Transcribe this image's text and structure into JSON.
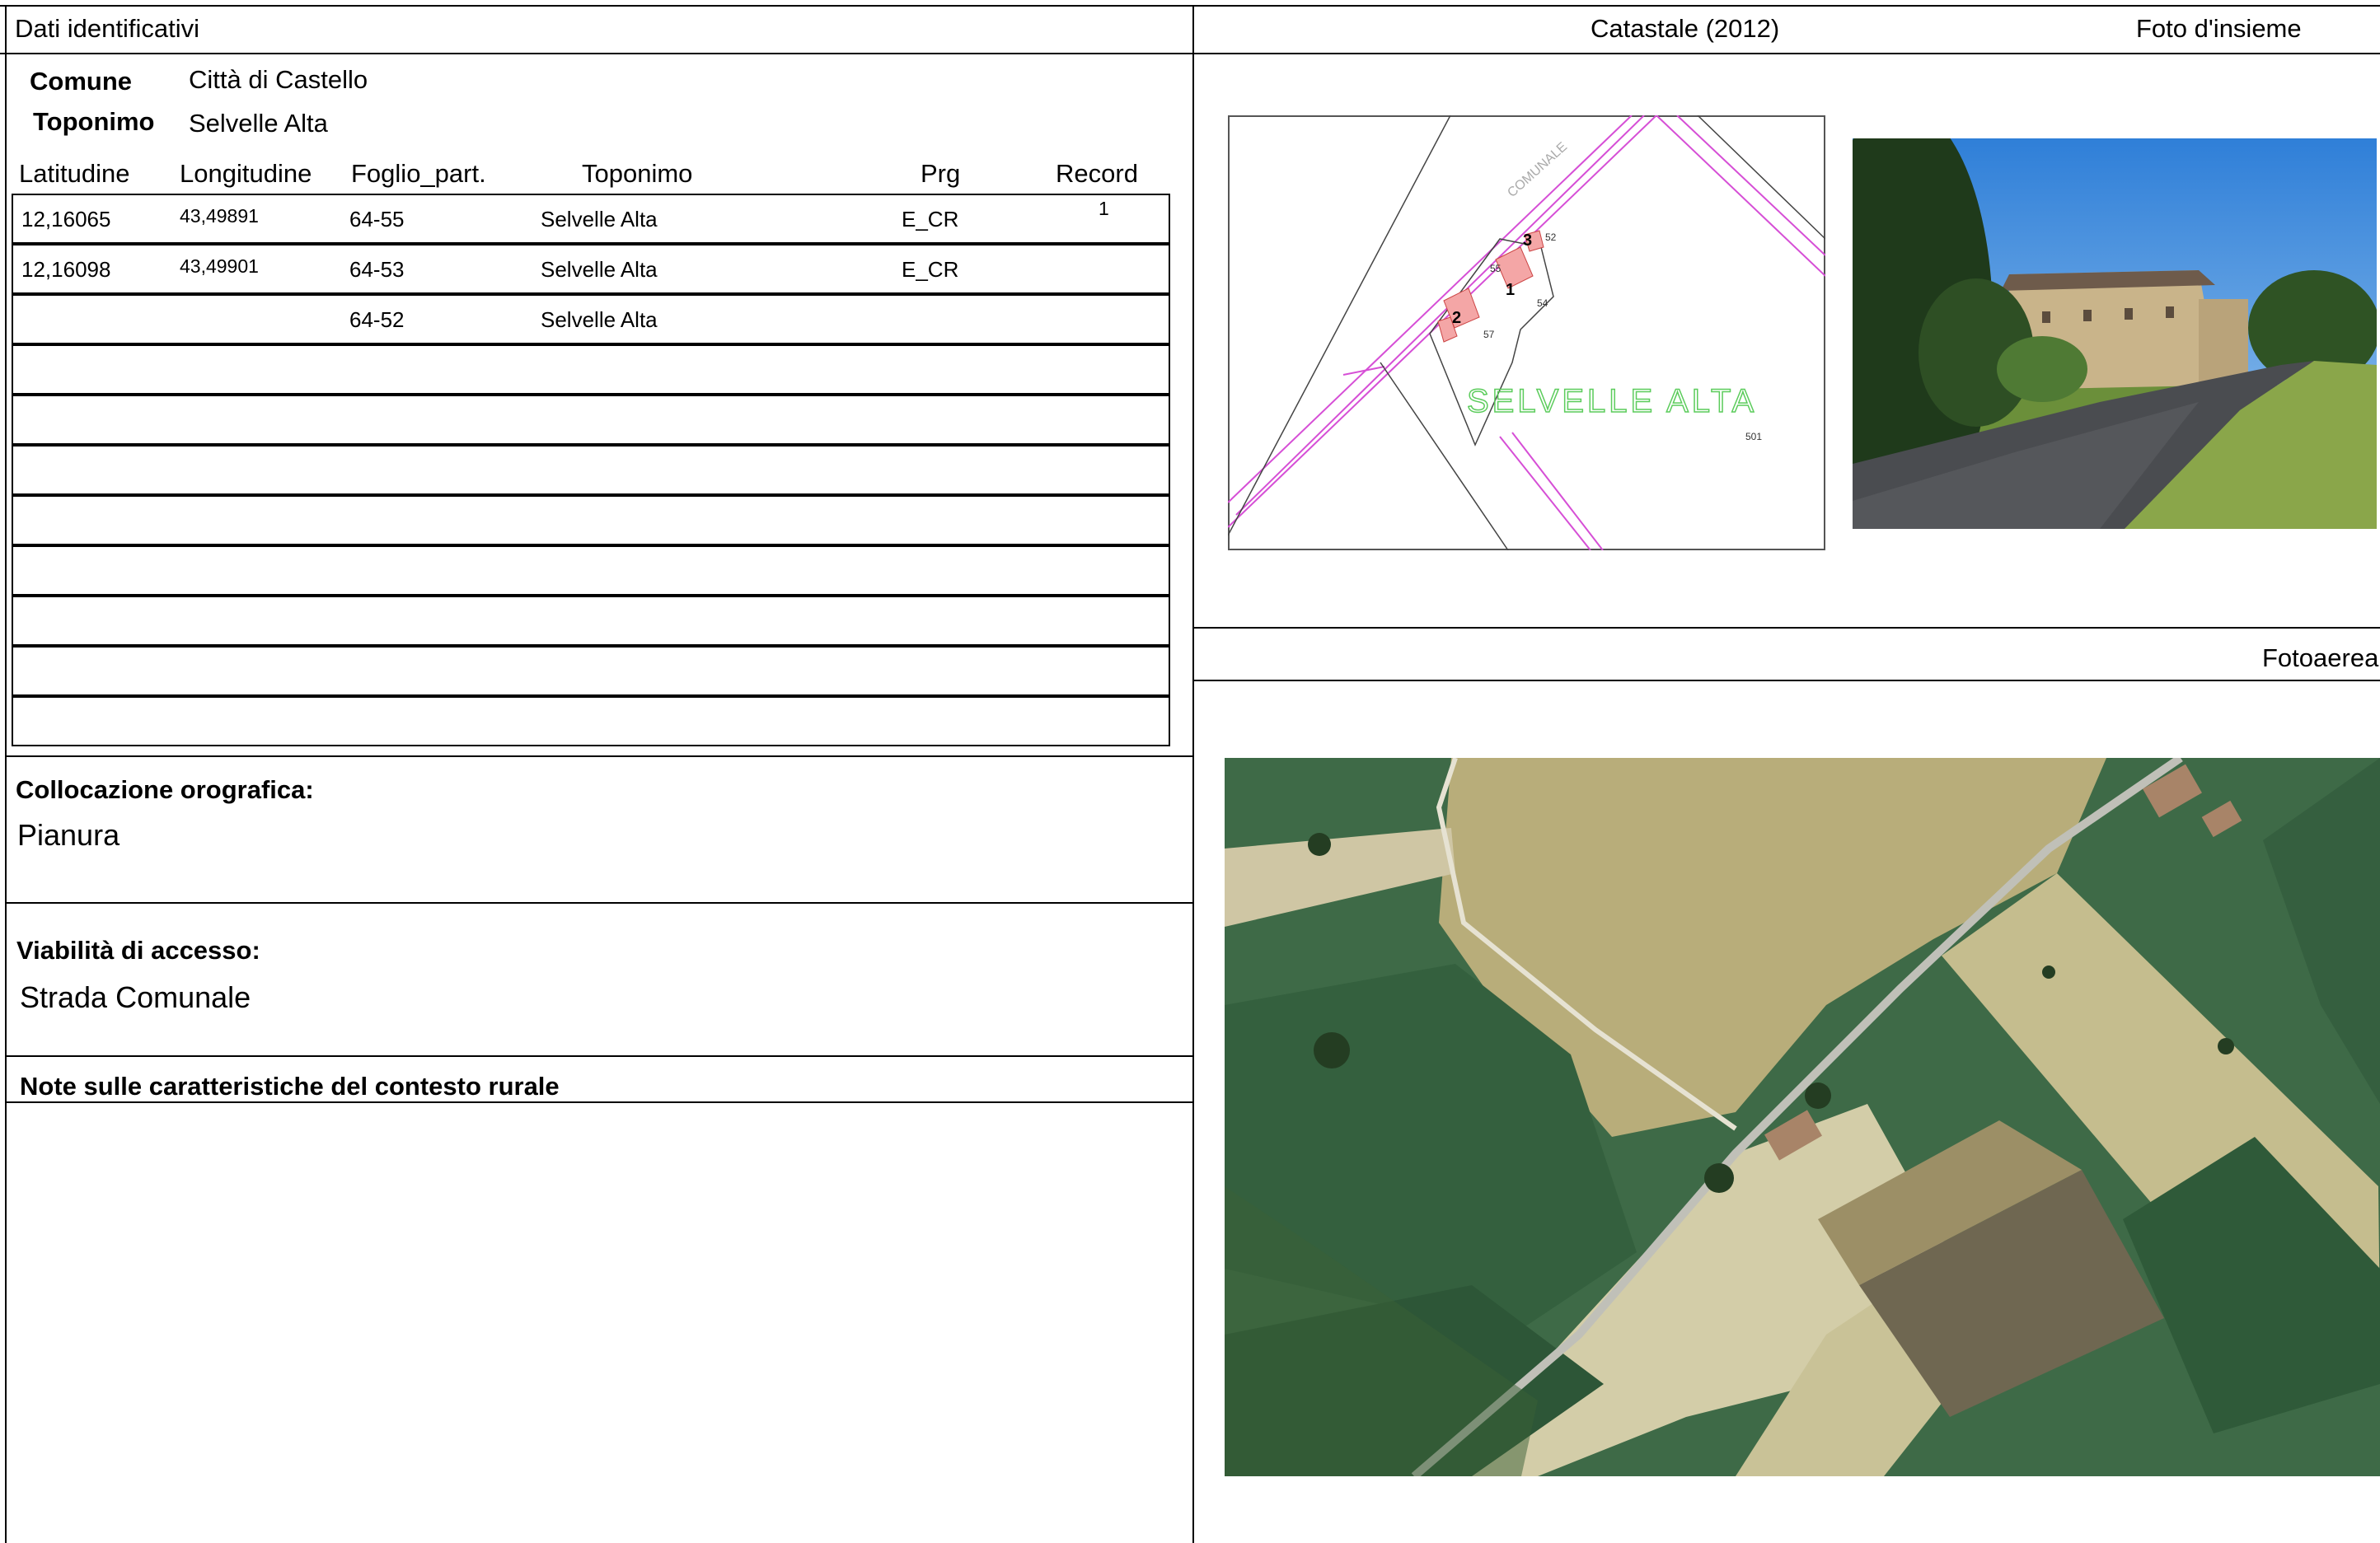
{
  "header": {
    "left_title": "Dati identificativi",
    "catastale_title": "Catastale (2012)",
    "foto_title": "Foto d'insieme",
    "fotoaerea_title": "Fotoaerea"
  },
  "identification": {
    "comune_label": "Comune",
    "comune_value": "Città di Castello",
    "toponimo_label": "Toponimo",
    "toponimo_value": "Selvelle Alta"
  },
  "table": {
    "columns": [
      "Latitudine",
      "Longitudine",
      "Foglio_part.",
      "Toponimo",
      "Prg",
      "Record"
    ],
    "rows": [
      [
        "12,16065",
        "43,49891",
        "64-55",
        "Selvelle Alta",
        "E_CR",
        "1"
      ],
      [
        "12,16098",
        "43,49901",
        "64-53",
        "Selvelle Alta",
        "E_CR",
        ""
      ],
      [
        "",
        "",
        "64-52",
        "Selvelle Alta",
        "",
        ""
      ],
      [
        "",
        "",
        "",
        "",
        "",
        ""
      ],
      [
        "",
        "",
        "",
        "",
        "",
        ""
      ],
      [
        "",
        "",
        "",
        "",
        "",
        ""
      ],
      [
        "",
        "",
        "",
        "",
        "",
        ""
      ],
      [
        "",
        "",
        "",
        "",
        "",
        ""
      ],
      [
        "",
        "",
        "",
        "",
        "",
        ""
      ],
      [
        "",
        "",
        "",
        "",
        "",
        ""
      ],
      [
        "",
        "",
        "",
        "",
        "",
        ""
      ]
    ]
  },
  "sections": {
    "orografia_label": "Collocazione orografica:",
    "orografia_value": "Pianura",
    "viabilita_label": "Viabilità di accesso:",
    "viabilita_value": "Strada Comunale",
    "note_label": "Note sulle caratteristiche del contesto rurale"
  },
  "cadastral_map": {
    "place_label": "SELVELLE ALTA",
    "road_label": "COMUNALE",
    "parcel_numbers": [
      "1",
      "2",
      "3"
    ],
    "parcel_small_labels": [
      "52",
      "54",
      "57",
      "55",
      "501"
    ]
  },
  "colors": {
    "road_lines": "#d64fd6",
    "buildings": "#f4a6a6",
    "place_label": "#5ccc5c",
    "field_dark": "#3f6a45",
    "field_light": "#c9c08c"
  }
}
